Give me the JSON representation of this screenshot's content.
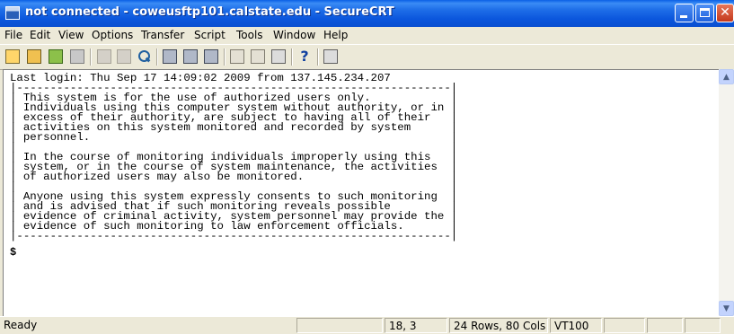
{
  "window": {
    "title": "not connected - coweusftp101.calstate.edu - SecureCRT",
    "minimize_icon": "minimize-icon",
    "maximize_icon": "maximize-icon",
    "close_icon": "close-icon",
    "close_glyph": "✕"
  },
  "menu": [
    "File",
    "Edit",
    "View",
    "Options",
    "Transfer",
    "Script",
    "Tools",
    "Window",
    "Help"
  ],
  "toolbar": {
    "icons": [
      "connect-icon",
      "quick-connect-icon",
      "connect-in-tab-icon",
      "disconnect-icon",
      "copy-icon",
      "paste-icon",
      "find-icon",
      "print-icon",
      "print-selection-icon",
      "print-screen-icon",
      "session-options-icon",
      "sftp-icon",
      "keymap-icon",
      "help-icon",
      "help-disabled-icon"
    ],
    "help_glyph": "?"
  },
  "terminal": {
    "lines": [
      "Last login: Thu Sep 17 14:09:02 2009 from 137.145.234.207",
      "|-----------------------------------------------------------------|",
      "| This system is for the use of authorized users only.            |",
      "| Individuals using this computer system without authority, or in |",
      "| excess of their authority, are subject to having all of their   |",
      "| activities on this system monitored and recorded by system      |",
      "| personnel.                                                      |",
      "|                                                                 |",
      "| In the course of monitoring individuals improperly using this   |",
      "| system, or in the course of system maintenance, the activities  |",
      "| of authorized users may also be monitored.                      |",
      "|                                                                 |",
      "| Anyone using this system expressly consents to such monitoring  |",
      "| and is advised that if such monitoring reveals possible         |",
      "| evidence of criminal activity, system personnel may provide the |",
      "| evidence of such monitoring to law enforcement officials.       |",
      "|-----------------------------------------------------------------|"
    ],
    "prompt": "$"
  },
  "scrollbar": {
    "up_arrow": "▲",
    "down_arrow": "▼"
  },
  "status": {
    "text": "Ready",
    "position": "18,  3",
    "size": "24 Rows, 80 Cols",
    "emulation": "VT100"
  }
}
